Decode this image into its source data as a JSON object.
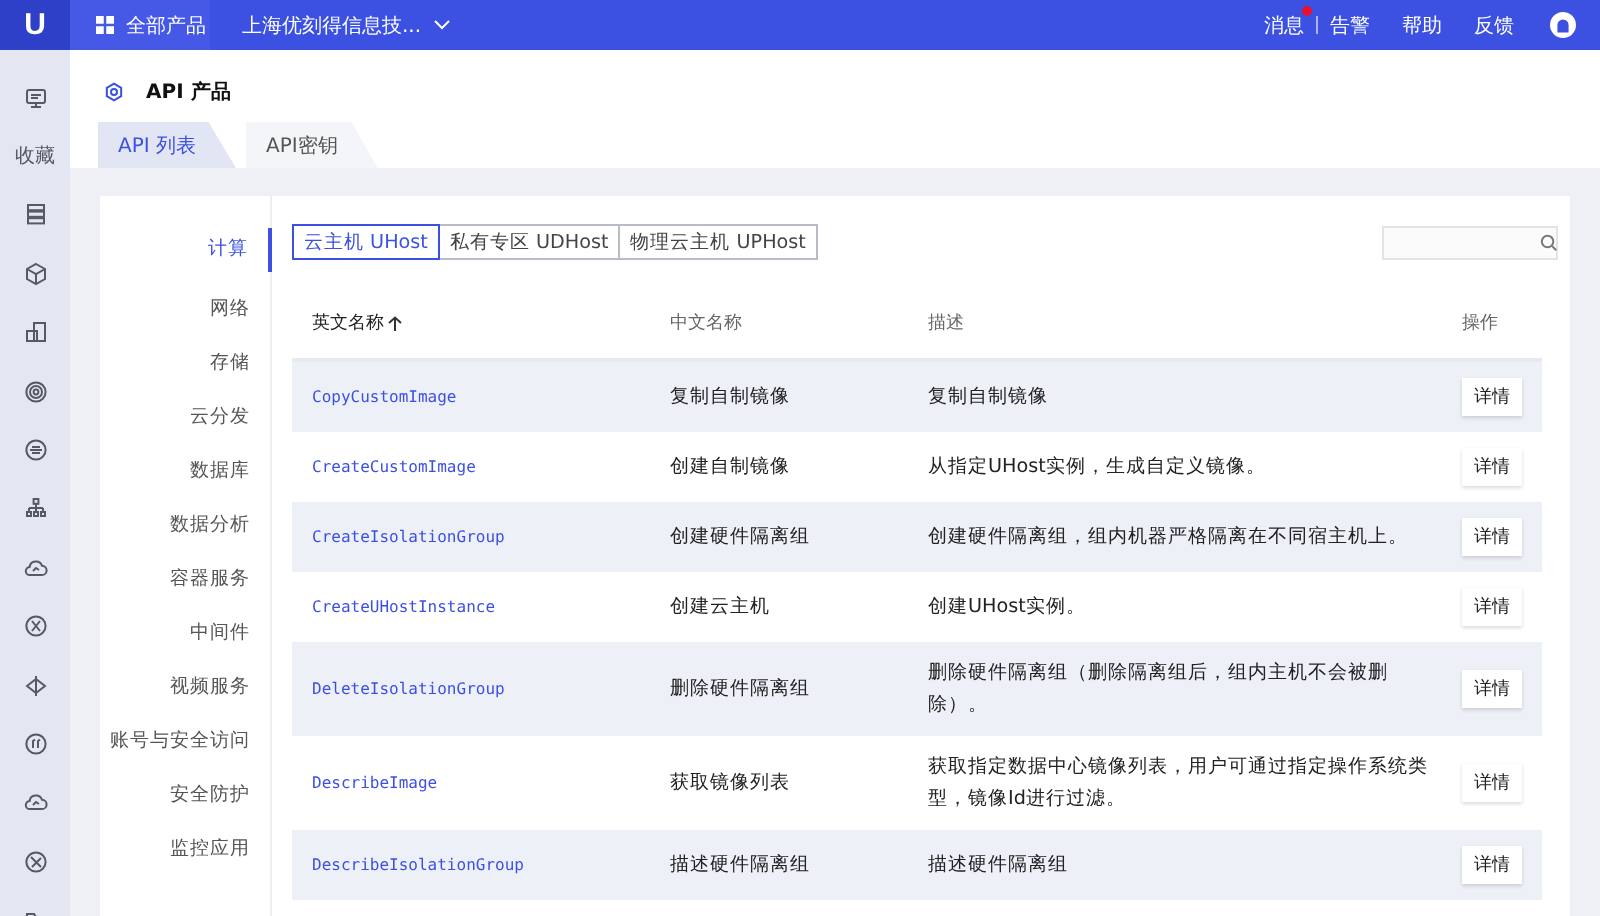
{
  "topbar": {
    "logo": "U",
    "all_products": "全部产品",
    "project": "上海优刻得信息技...",
    "links": [
      {
        "label": "消息",
        "badge": true
      },
      {
        "label": "告警",
        "badge": false
      },
      {
        "label": "帮助",
        "badge": false
      },
      {
        "label": "反馈",
        "badge": false
      }
    ]
  },
  "rail": {
    "label": "收藏"
  },
  "page": {
    "title": "API 产品"
  },
  "tabs": [
    {
      "label": "API 列表",
      "selected": true
    },
    {
      "label": "API密钥",
      "selected": false
    }
  ],
  "categories": [
    {
      "label": "计算",
      "selected": true
    },
    {
      "label": "网络",
      "selected": false
    },
    {
      "label": "存储",
      "selected": false
    },
    {
      "label": "云分发",
      "selected": false
    },
    {
      "label": "数据库",
      "selected": false
    },
    {
      "label": "数据分析",
      "selected": false
    },
    {
      "label": "容器服务",
      "selected": false
    },
    {
      "label": "中间件",
      "selected": false
    },
    {
      "label": "视频服务",
      "selected": false
    },
    {
      "label": "账号与安全访问",
      "selected": false
    },
    {
      "label": "安全防护",
      "selected": false
    },
    {
      "label": "监控应用",
      "selected": false
    }
  ],
  "products": [
    {
      "label": "云主机 UHost",
      "selected": true
    },
    {
      "label": "私有专区 UDHost",
      "selected": false
    },
    {
      "label": "物理云主机 UPHost",
      "selected": false
    }
  ],
  "table": {
    "columns": [
      "英文名称",
      "中文名称",
      "描述",
      "操作"
    ],
    "rows": [
      {
        "name": "CopyCustomImage",
        "cn": "复制自制镜像",
        "desc": "复制自制镜像",
        "action": "详情"
      },
      {
        "name": "CreateCustomImage",
        "cn": "创建自制镜像",
        "desc": "从指定UHost实例，生成自定义镜像。",
        "action": "详情"
      },
      {
        "name": "CreateIsolationGroup",
        "cn": "创建硬件隔离组",
        "desc": "创建硬件隔离组，组内机器严格隔离在不同宿主机上。",
        "action": "详情"
      },
      {
        "name": "CreateUHostInstance",
        "cn": "创建云主机",
        "desc": "创建UHost实例。",
        "action": "详情"
      },
      {
        "name": "DeleteIsolationGroup",
        "cn": "删除硬件隔离组",
        "desc": "删除硬件隔离组（删除隔离组后，组内主机不会被删除）。",
        "action": "详情"
      },
      {
        "name": "DescribeImage",
        "cn": "获取镜像列表",
        "desc": "获取指定数据中心镜像列表，用户可通过指定操作系统类型，镜像Id进行过滤。",
        "action": "详情"
      },
      {
        "name": "DescribeIsolationGroup",
        "cn": "描述硬件隔离组",
        "desc": "描述硬件隔离组",
        "action": "详情"
      }
    ]
  }
}
